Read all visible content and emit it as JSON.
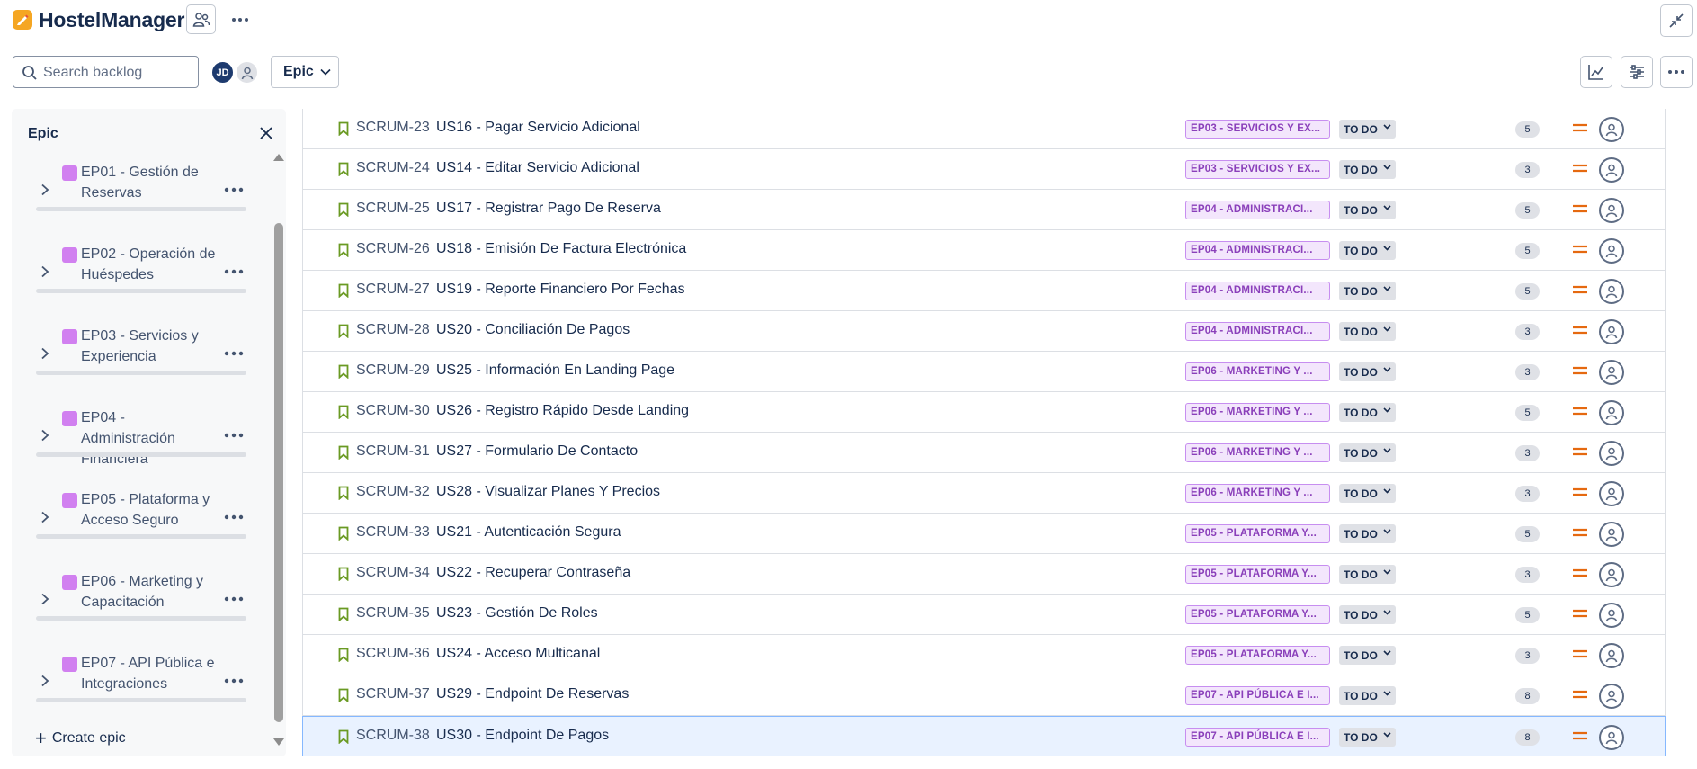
{
  "app": {
    "title": "HostelManager",
    "logo_icon": "pencil-icon",
    "logo_color": "#f5a623"
  },
  "toolbar": {
    "search_placeholder": "Search backlog",
    "avatar_initials": "JD",
    "avatar_color": "#1d3a6e",
    "epic_filter_label": "Epic"
  },
  "epic_panel": {
    "title": "Epic",
    "create_label": "Create epic",
    "epic_color": "#d180f0",
    "epics": [
      {
        "name": "EP01 - Gestión de Reservas"
      },
      {
        "name": "EP02 - Operación de Huéspedes"
      },
      {
        "name": "EP03 - Servicios y Experiencia"
      },
      {
        "name": "EP04 - Administración Financiera"
      },
      {
        "name": "EP05 - Plataforma y Acceso Seguro"
      },
      {
        "name": "EP06 - Marketing y Capacitación"
      },
      {
        "name": "EP07 - API Pública e Integraciones"
      }
    ]
  },
  "backlog": {
    "rows": [
      {
        "key": "SCRUM-23",
        "summary": "US16 - Pagar Servicio Adicional",
        "epic": "EP03 - SERVICIOS Y EX...",
        "status": "TO DO",
        "points": "5"
      },
      {
        "key": "SCRUM-24",
        "summary": "US14 - Editar Servicio Adicional",
        "epic": "EP03 - SERVICIOS Y EX...",
        "status": "TO DO",
        "points": "3"
      },
      {
        "key": "SCRUM-25",
        "summary": "US17 - Registrar Pago De Reserva",
        "epic": "EP04 - ADMINISTRACI...",
        "status": "TO DO",
        "points": "5"
      },
      {
        "key": "SCRUM-26",
        "summary": "US18 - Emisión De Factura Electrónica",
        "epic": "EP04 - ADMINISTRACI...",
        "status": "TO DO",
        "points": "5"
      },
      {
        "key": "SCRUM-27",
        "summary": "US19 - Reporte Financiero Por Fechas",
        "epic": "EP04 - ADMINISTRACI...",
        "status": "TO DO",
        "points": "5"
      },
      {
        "key": "SCRUM-28",
        "summary": "US20 - Conciliación De Pagos",
        "epic": "EP04 - ADMINISTRACI...",
        "status": "TO DO",
        "points": "3"
      },
      {
        "key": "SCRUM-29",
        "summary": "US25 - Información En Landing Page",
        "epic": "EP06 - MARKETING Y ...",
        "status": "TO DO",
        "points": "3"
      },
      {
        "key": "SCRUM-30",
        "summary": "US26 - Registro Rápido Desde Landing",
        "epic": "EP06 - MARKETING Y ...",
        "status": "TO DO",
        "points": "5"
      },
      {
        "key": "SCRUM-31",
        "summary": "US27 - Formulario De Contacto",
        "epic": "EP06 - MARKETING Y ...",
        "status": "TO DO",
        "points": "3"
      },
      {
        "key": "SCRUM-32",
        "summary": "US28 - Visualizar Planes Y Precios",
        "epic": "EP06 - MARKETING Y ...",
        "status": "TO DO",
        "points": "3"
      },
      {
        "key": "SCRUM-33",
        "summary": "US21 - Autenticación Segura",
        "epic": "EP05 - PLATAFORMA Y...",
        "status": "TO DO",
        "points": "5"
      },
      {
        "key": "SCRUM-34",
        "summary": "US22 - Recuperar Contraseña",
        "epic": "EP05 - PLATAFORMA Y...",
        "status": "TO DO",
        "points": "3"
      },
      {
        "key": "SCRUM-35",
        "summary": "US23 - Gestión De Roles",
        "epic": "EP05 - PLATAFORMA Y...",
        "status": "TO DO",
        "points": "5"
      },
      {
        "key": "SCRUM-36",
        "summary": "US24 - Acceso Multicanal",
        "epic": "EP05 - PLATAFORMA Y...",
        "status": "TO DO",
        "points": "3"
      },
      {
        "key": "SCRUM-37",
        "summary": "US29 - Endpoint De Reservas",
        "epic": "EP07 - API PÚBLICA E I...",
        "status": "TO DO",
        "points": "8"
      },
      {
        "key": "SCRUM-38",
        "summary": "US30 - Endpoint De Pagos",
        "epic": "EP07 - API PÚBLICA E I...",
        "status": "TO DO",
        "points": "8",
        "selected": true
      }
    ],
    "story_icon_color": "#6a9a23",
    "priority_color": "#e56910"
  }
}
